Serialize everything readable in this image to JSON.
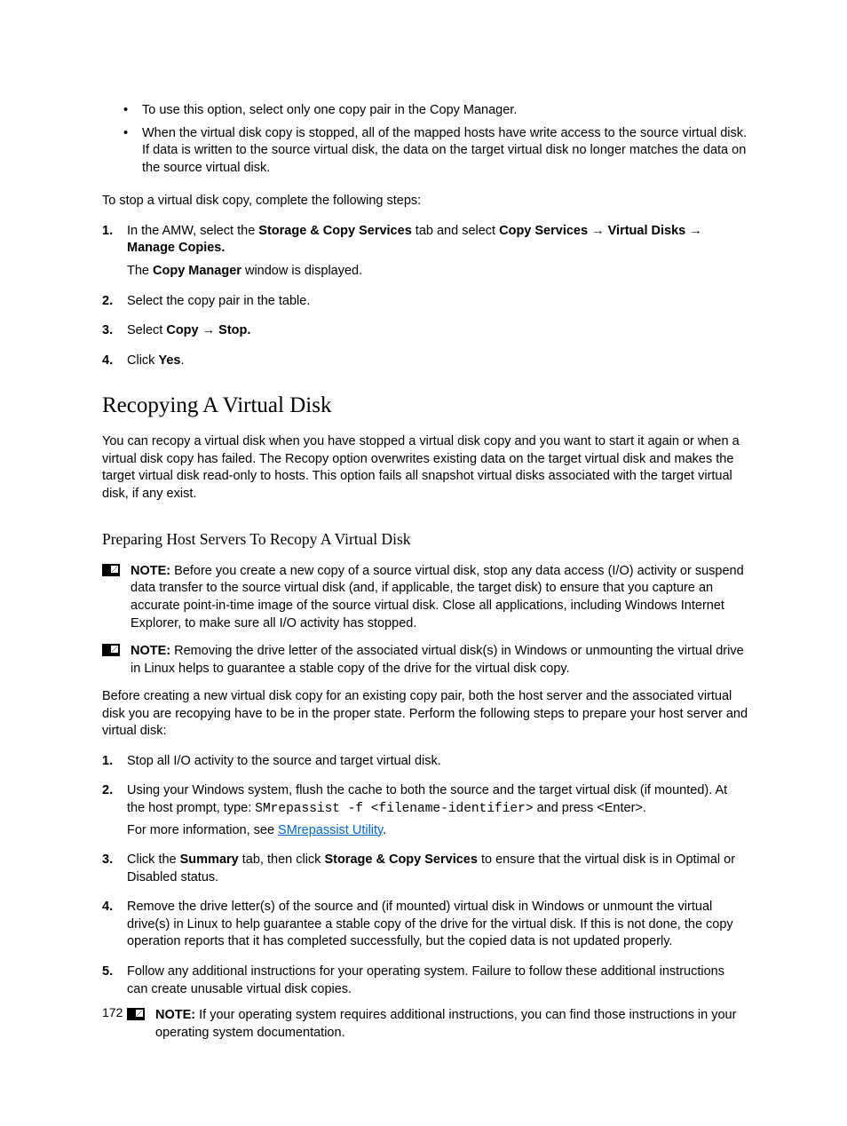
{
  "bullets": {
    "b1": "To use this option, select only one copy pair in the Copy Manager.",
    "b2": "When the virtual disk copy is stopped, all of the mapped hosts have write access to the source virtual disk. If data is written to the source virtual disk, the data on the target virtual disk no longer matches the data on the source virtual disk."
  },
  "intro_para": "To stop a virtual disk copy, complete the following steps:",
  "step1": {
    "p1a": "In the AMW, select the ",
    "p1b": "Storage & Copy Services",
    "p1c": " tab and select ",
    "p1d": "Copy Services",
    "p1e": "Virtual Disks",
    "p1f": "Manage Copies.",
    "p2a": "The ",
    "p2b": "Copy Manager",
    "p2c": " window is displayed."
  },
  "step2": "Select the copy pair in the table.",
  "step3": {
    "a": "Select ",
    "b": "Copy",
    "c": "Stop."
  },
  "step4": {
    "a": "Click ",
    "b": "Yes"
  },
  "h1": "Recopying A Virtual Disk",
  "h1_para": "You can recopy a virtual disk when you have stopped a virtual disk copy and you want to start it again or when a virtual disk copy has failed. The Recopy option overwrites existing data on the target virtual disk and makes the target virtual disk read-only to hosts. This option fails all snapshot virtual disks associated with the target virtual disk, if any exist.",
  "h2": "Preparing Host Servers To Recopy A Virtual Disk",
  "note1": {
    "label": "NOTE: ",
    "body": "Before you create a new copy of a source virtual disk, stop any data access (I/O) activity or suspend data transfer to the source virtual disk (and, if applicable, the target disk) to ensure that you capture an accurate point-in-time image of the source virtual disk. Close all applications, including Windows Internet Explorer, to make sure all I/O activity has stopped."
  },
  "note2": {
    "label": "NOTE: ",
    "body": "Removing the drive letter of the associated virtual disk(s) in Windows or unmounting the virtual drive in Linux helps to guarantee a stable copy of the drive for the virtual disk copy."
  },
  "prep_para": "Before creating a new virtual disk copy for an existing copy pair, both the host server and the associated virtual disk you are recopying have to be in the proper state. Perform the following steps to prepare your host server and virtual disk:",
  "prep_steps": {
    "s1": "Stop all I/O activity to the source and target virtual disk.",
    "s2a": "Using your Windows system, flush the cache to both the source and the target virtual disk (if mounted). At the host prompt, type: ",
    "s2cmd": "SMrepassist -f <filename-identifier>",
    "s2b": " and press <Enter>.",
    "s2c": "For more information, see ",
    "s2link": "SMrepassist Utility",
    "s2d": ".",
    "s3a": "Click the ",
    "s3b": "Summary",
    "s3c": " tab, then click ",
    "s3d": "Storage & Copy Services",
    "s3e": " to ensure that the virtual disk is in Optimal or Disabled status.",
    "s4": "Remove the drive letter(s) of the source and (if mounted) virtual disk in Windows or unmount the virtual drive(s) in Linux to help guarantee a stable copy of the drive for the virtual disk. If this is not done, the copy operation reports that it has completed successfully, but the copied data is not updated properly.",
    "s5": "Follow any additional instructions for your operating system. Failure to follow these additional instructions can create unusable virtual disk copies.",
    "s5note_label": "NOTE: ",
    "s5note_body": "If your operating system requires additional instructions, you can find those instructions in your operating system documentation."
  },
  "arrow": " → ",
  "page_number": "172"
}
